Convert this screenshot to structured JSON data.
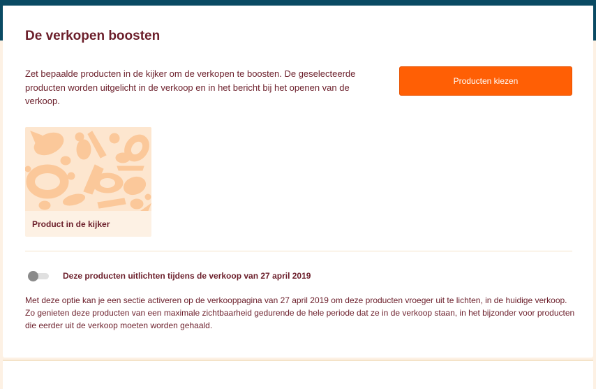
{
  "section": {
    "title": "De verkopen boosten",
    "description": "Zet bepaalde producten in de kijker om de verkopen te boosten. De geselecteerde producten worden uitgelicht in de verkoop en in het bericht bij het openen van de verkoop.",
    "choose_button_label": "Producten kiezen"
  },
  "product_card": {
    "label": "Product in de kijker",
    "image_icon": "vegetables-illustration"
  },
  "toggle": {
    "state": "off",
    "label": "Deze producten uitlichten tijdens de verkoop van 27 april 2019"
  },
  "info_text": "Met deze optie kan je een sectie activeren op de verkooppagina van 27 april 2019 om deze producten vroeger uit te lichten, in de huidige verkoop. Zo genieten deze producten van een maximale zichtbaarheid gedurende de hele periode dat ze in de verkoop staan, in het bijzonder voor producten die eerder uit de verkoop moeten worden gehaald.",
  "colors": {
    "accent": "#ff5f05",
    "text": "#6b1e2a",
    "topbar": "#0a4a63",
    "background": "#fdf1e4"
  }
}
